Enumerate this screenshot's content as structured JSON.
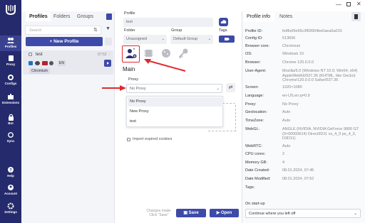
{
  "sidebar": {
    "items": [
      {
        "label": "Profiles"
      },
      {
        "label": "Proxy"
      },
      {
        "label": "Configs"
      },
      {
        "label": "Extensions"
      },
      {
        "label": "Bot"
      },
      {
        "label": "Sync"
      },
      {
        "label": "Help"
      },
      {
        "label": "Account"
      },
      {
        "label": "Settings"
      }
    ]
  },
  "profiles_panel": {
    "tabs": [
      "Profiles",
      "Folders",
      "Groups"
    ],
    "search_placeholder": "Search",
    "new_profile_label": "+ New Profile",
    "profile": {
      "name": "test",
      "time": "07:52",
      "country": "EN",
      "browser_badge": "Chromium"
    }
  },
  "editor": {
    "profile_label": "Profile",
    "profile_value": "test",
    "tags_label": "Tags",
    "folder_label": "Folder",
    "folder_value": "Unassigned",
    "group_label": "Group",
    "group_value": "Default Group",
    "section_title": "Main",
    "proxy_label": "Proxy",
    "proxy_value": "No Proxy",
    "proxy_options": [
      "No Proxy",
      "New Proxy",
      "test"
    ],
    "import_label": "Import expired cookies",
    "changes_note": "Changes made. Click \"Save\"",
    "save_label": "Save",
    "open_label": "Open"
  },
  "info_panel": {
    "tabs": [
      "Profile info",
      "Notes"
    ],
    "rows": [
      {
        "key": "Profile ID:",
        "value": "fe86ef3e95c3f69904be0aea5a015"
      },
      {
        "key": "Config ID:",
        "value": "513606"
      },
      {
        "key": "Browser core:",
        "value": "Chromium"
      },
      {
        "key": "OS:",
        "value": "Windows 10"
      },
      {
        "key": "Browser:",
        "value": "Chrome 120.0.0.0"
      },
      {
        "key": "User-Agent:",
        "value": "Mozilla/5.0 (Windows NT 10.0; Win64; x64) AppleWebKit/537.36 (KHTML, like Gecko) Chrome/120.0.0.0 Safari/537.36"
      },
      {
        "key": "Screen:",
        "value": "1920×1080"
      },
      {
        "key": "Language:",
        "value": "en-US,en;q=0.9"
      },
      {
        "key": "Proxy:",
        "value": "No Proxy"
      },
      {
        "key": "Geolocation:",
        "value": "Auto"
      },
      {
        "key": "TimeZone:",
        "value": "Auto"
      },
      {
        "key": "WebGL:",
        "value": "ANGLE (NVIDIA, NVIDIA GeForce 9800 GT (0×00000614) Direct3D11 vs_4_0 ps_4_0, D3D11)"
      },
      {
        "key": "WebRTC:",
        "value": "Auto"
      },
      {
        "key": "CPU cores:",
        "value": "2"
      },
      {
        "key": "Memory GB:",
        "value": "4"
      },
      {
        "key": "Date Created:",
        "value": "08.01.2024, 07:46"
      },
      {
        "key": "Date Modified:",
        "value": "08.01.2024, 07:52"
      },
      {
        "key": "Tags:",
        "value": ""
      }
    ],
    "startup_label": "On start-up",
    "startup_value": "Continue where you left off"
  },
  "colors": {
    "sidebar": "#242a6b",
    "accent": "#3d4aa8",
    "annotation": "#e0282e"
  }
}
